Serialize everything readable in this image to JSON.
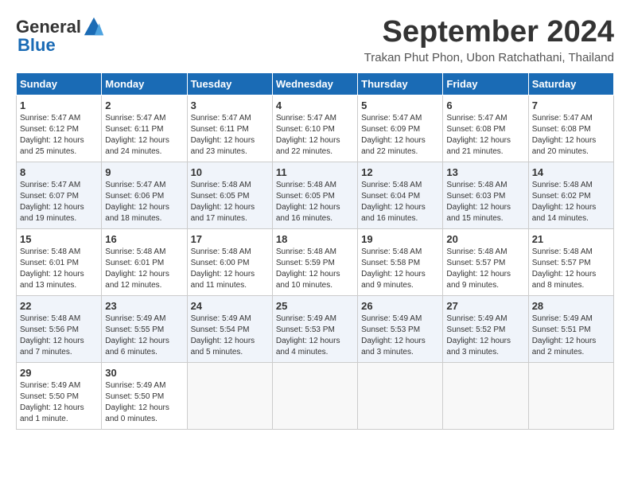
{
  "logo": {
    "general": "General",
    "blue": "Blue"
  },
  "header": {
    "month": "September 2024",
    "location": "Trakan Phut Phon, Ubon Ratchathani, Thailand"
  },
  "days_of_week": [
    "Sunday",
    "Monday",
    "Tuesday",
    "Wednesday",
    "Thursday",
    "Friday",
    "Saturday"
  ],
  "weeks": [
    [
      {
        "day": "1",
        "sunrise": "5:47 AM",
        "sunset": "6:12 PM",
        "daylight": "12 hours and 25 minutes."
      },
      {
        "day": "2",
        "sunrise": "5:47 AM",
        "sunset": "6:11 PM",
        "daylight": "12 hours and 24 minutes."
      },
      {
        "day": "3",
        "sunrise": "5:47 AM",
        "sunset": "6:11 PM",
        "daylight": "12 hours and 23 minutes."
      },
      {
        "day": "4",
        "sunrise": "5:47 AM",
        "sunset": "6:10 PM",
        "daylight": "12 hours and 22 minutes."
      },
      {
        "day": "5",
        "sunrise": "5:47 AM",
        "sunset": "6:09 PM",
        "daylight": "12 hours and 22 minutes."
      },
      {
        "day": "6",
        "sunrise": "5:47 AM",
        "sunset": "6:08 PM",
        "daylight": "12 hours and 21 minutes."
      },
      {
        "day": "7",
        "sunrise": "5:47 AM",
        "sunset": "6:08 PM",
        "daylight": "12 hours and 20 minutes."
      }
    ],
    [
      {
        "day": "8",
        "sunrise": "5:47 AM",
        "sunset": "6:07 PM",
        "daylight": "12 hours and 19 minutes."
      },
      {
        "day": "9",
        "sunrise": "5:47 AM",
        "sunset": "6:06 PM",
        "daylight": "12 hours and 18 minutes."
      },
      {
        "day": "10",
        "sunrise": "5:48 AM",
        "sunset": "6:05 PM",
        "daylight": "12 hours and 17 minutes."
      },
      {
        "day": "11",
        "sunrise": "5:48 AM",
        "sunset": "6:05 PM",
        "daylight": "12 hours and 16 minutes."
      },
      {
        "day": "12",
        "sunrise": "5:48 AM",
        "sunset": "6:04 PM",
        "daylight": "12 hours and 16 minutes."
      },
      {
        "day": "13",
        "sunrise": "5:48 AM",
        "sunset": "6:03 PM",
        "daylight": "12 hours and 15 minutes."
      },
      {
        "day": "14",
        "sunrise": "5:48 AM",
        "sunset": "6:02 PM",
        "daylight": "12 hours and 14 minutes."
      }
    ],
    [
      {
        "day": "15",
        "sunrise": "5:48 AM",
        "sunset": "6:01 PM",
        "daylight": "12 hours and 13 minutes."
      },
      {
        "day": "16",
        "sunrise": "5:48 AM",
        "sunset": "6:01 PM",
        "daylight": "12 hours and 12 minutes."
      },
      {
        "day": "17",
        "sunrise": "5:48 AM",
        "sunset": "6:00 PM",
        "daylight": "12 hours and 11 minutes."
      },
      {
        "day": "18",
        "sunrise": "5:48 AM",
        "sunset": "5:59 PM",
        "daylight": "12 hours and 10 minutes."
      },
      {
        "day": "19",
        "sunrise": "5:48 AM",
        "sunset": "5:58 PM",
        "daylight": "12 hours and 9 minutes."
      },
      {
        "day": "20",
        "sunrise": "5:48 AM",
        "sunset": "5:57 PM",
        "daylight": "12 hours and 9 minutes."
      },
      {
        "day": "21",
        "sunrise": "5:48 AM",
        "sunset": "5:57 PM",
        "daylight": "12 hours and 8 minutes."
      }
    ],
    [
      {
        "day": "22",
        "sunrise": "5:48 AM",
        "sunset": "5:56 PM",
        "daylight": "12 hours and 7 minutes."
      },
      {
        "day": "23",
        "sunrise": "5:49 AM",
        "sunset": "5:55 PM",
        "daylight": "12 hours and 6 minutes."
      },
      {
        "day": "24",
        "sunrise": "5:49 AM",
        "sunset": "5:54 PM",
        "daylight": "12 hours and 5 minutes."
      },
      {
        "day": "25",
        "sunrise": "5:49 AM",
        "sunset": "5:53 PM",
        "daylight": "12 hours and 4 minutes."
      },
      {
        "day": "26",
        "sunrise": "5:49 AM",
        "sunset": "5:53 PM",
        "daylight": "12 hours and 3 minutes."
      },
      {
        "day": "27",
        "sunrise": "5:49 AM",
        "sunset": "5:52 PM",
        "daylight": "12 hours and 3 minutes."
      },
      {
        "day": "28",
        "sunrise": "5:49 AM",
        "sunset": "5:51 PM",
        "daylight": "12 hours and 2 minutes."
      }
    ],
    [
      {
        "day": "29",
        "sunrise": "5:49 AM",
        "sunset": "5:50 PM",
        "daylight": "12 hours and 1 minute."
      },
      {
        "day": "30",
        "sunrise": "5:49 AM",
        "sunset": "5:50 PM",
        "daylight": "12 hours and 0 minutes."
      },
      null,
      null,
      null,
      null,
      null
    ]
  ]
}
